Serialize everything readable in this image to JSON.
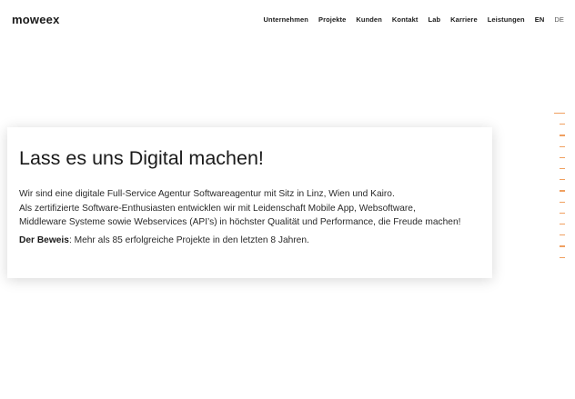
{
  "header": {
    "logo": "moweex",
    "nav": [
      {
        "label": "Unternehmen"
      },
      {
        "label": "Projekte"
      },
      {
        "label": "Kunden"
      },
      {
        "label": "Kontakt"
      },
      {
        "label": "Lab"
      },
      {
        "label": "Karriere"
      },
      {
        "label": "Leistungen"
      }
    ],
    "lang_en": "EN",
    "lang_de": "DE"
  },
  "hero": {
    "title": "Lass es uns Digital machen!",
    "line1": "Wir sind eine digitale Full-Service Agentur Softwareagentur mit Sitz in Linz, Wien und Kairo.",
    "line2": "Als zertifizierte Software-Enthusiasten entwicklen wir mit Leidenschaft Mobile App, Websoftware,",
    "line3": "Middleware Systeme sowie Webservices (API’s) in höchster Qualität und Performance, die Freude machen!",
    "proof_label": "Der Beweis",
    "proof_text": ": Mehr als 85 erfolgreiche Projekte in den letzten 8 Jahren."
  },
  "accent_color": "#f0a060"
}
